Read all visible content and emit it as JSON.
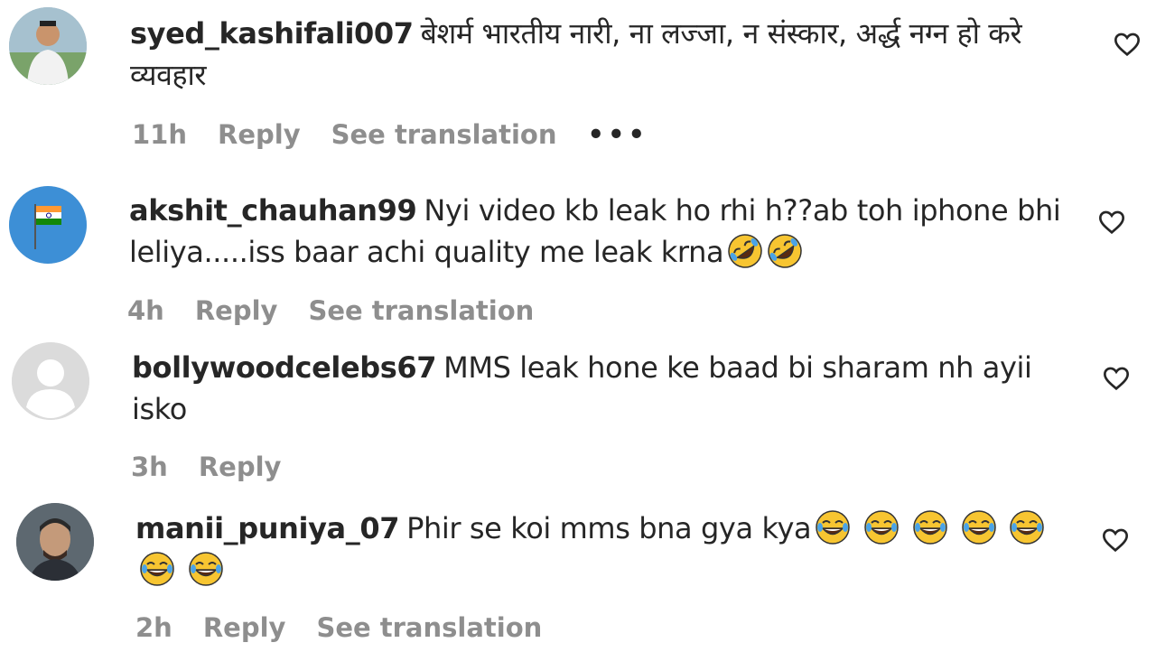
{
  "comments": [
    {
      "username": "syed_kashifali007",
      "text": "बेशर्म भारतीय नारी, ना लज्जा, न संस्कार, अर्द्ध नग्न हो करे व्यवहार",
      "time": "11h",
      "reply": "Reply",
      "translate": "See translation",
      "more": "•••"
    },
    {
      "username": "akshit_chauhan99",
      "text": "Nyi video kb leak ho rhi h??ab toh iphone bhi leliya.....iss baar achi quality me leak krna",
      "time": "4h",
      "reply": "Reply",
      "translate": "See translation"
    },
    {
      "username": "bollywoodcelebs67",
      "text": "MMS leak hone ke baad bi sharam nh ayii isko",
      "time": "3h",
      "reply": "Reply"
    },
    {
      "username": "manii_puniya_07",
      "text": "Phir se koi mms bna gya kya",
      "time": "2h",
      "reply": "Reply",
      "translate": "See translation"
    }
  ],
  "icons": {
    "like": "heart-outline-icon",
    "rofl_emoji": "rolling-on-floor-laughing-emoji",
    "laugh_emoji": "face-with-tears-of-joy-emoji"
  },
  "colors": {
    "text": "#262626",
    "meta": "#8e8e8e",
    "emoji": "#f7c531"
  }
}
